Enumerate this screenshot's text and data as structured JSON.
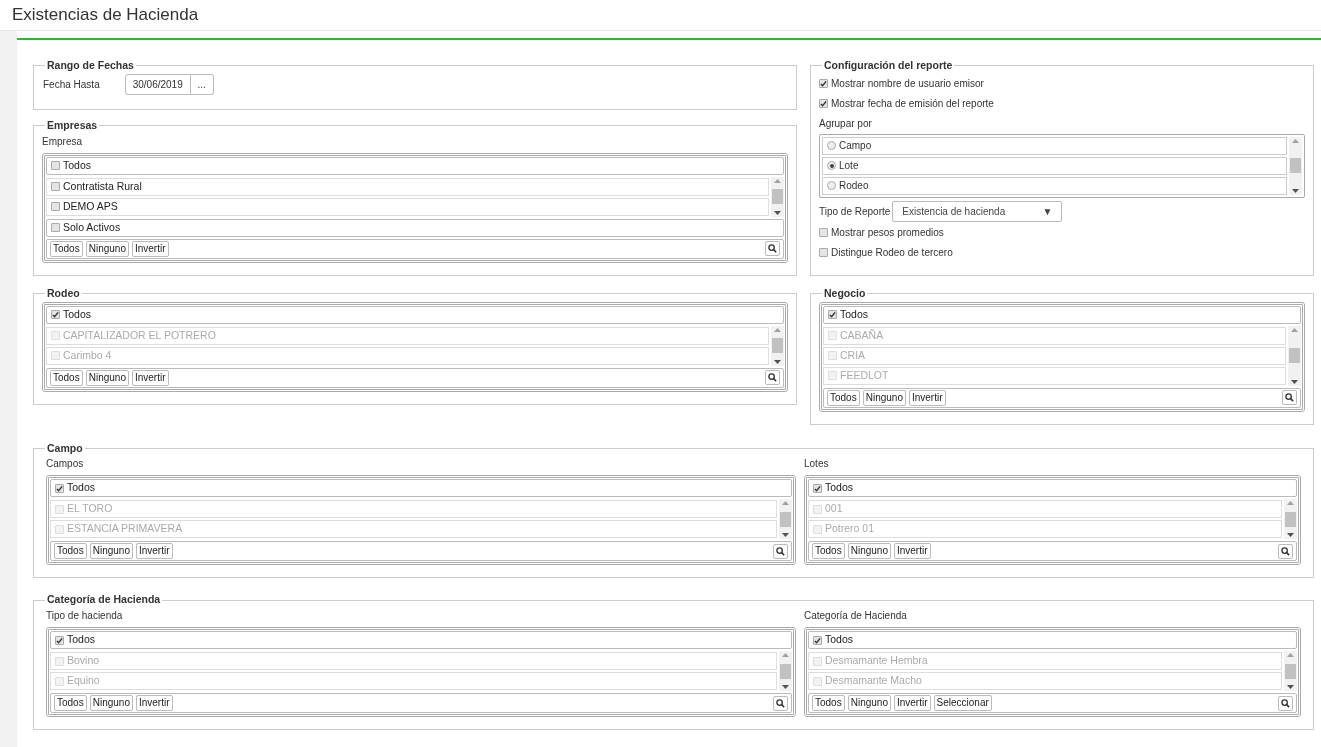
{
  "title": "Existencias de Hacienda",
  "date_range": {
    "legend": "Rango de Fechas",
    "label": "Fecha Hasta",
    "value": "30/06/2019",
    "button": "..."
  },
  "empresas": {
    "legend": "Empresas",
    "label": "Empresa",
    "list": {
      "all": {
        "label": "Todos",
        "checked": false
      },
      "items": [
        {
          "label": "Contratista Rural",
          "checked": false,
          "disabled": false
        },
        {
          "label": "DEMO APS",
          "checked": false,
          "disabled": false
        }
      ],
      "extra": {
        "label": "Solo Activos",
        "checked": false
      },
      "actions": [
        "Todos",
        "Ninguno",
        "Invertir"
      ]
    }
  },
  "config": {
    "legend": "Configuración del reporte",
    "options_top": [
      {
        "label": "Mostrar nombre de usuario emisor",
        "checked": true
      },
      {
        "label": "Mostrar fecha de emisión del reporte",
        "checked": true
      }
    ],
    "group_by": {
      "label": "Agrupar por",
      "options": [
        {
          "label": "Campo",
          "selected": false
        },
        {
          "label": "Lote",
          "selected": true
        },
        {
          "label": "Rodeo",
          "selected": false
        }
      ]
    },
    "report_type": {
      "label": "Tipo de Reporte",
      "value": "Existencia de hacienda",
      "caret": "▼"
    },
    "options_bottom": [
      {
        "label": "Mostrar pesos promedios",
        "checked": false
      },
      {
        "label": "Distingue Rodeo de tercero",
        "checked": false
      }
    ]
  },
  "rodeo": {
    "legend": "Rodeo",
    "list": {
      "all": {
        "label": "Todos",
        "checked": true
      },
      "items": [
        {
          "label": "CAPITALIZADOR EL POTRERO",
          "checked": false,
          "disabled": true
        },
        {
          "label": "Carimbo 4",
          "checked": false,
          "disabled": true
        }
      ],
      "actions": [
        "Todos",
        "Ninguno",
        "Invertir"
      ]
    }
  },
  "negocio": {
    "legend": "Negocio",
    "list": {
      "all": {
        "label": "Todos",
        "checked": true
      },
      "items": [
        {
          "label": "CABAÑA",
          "checked": false,
          "disabled": true
        },
        {
          "label": "CRIA",
          "checked": false,
          "disabled": true
        },
        {
          "label": "FEEDLOT",
          "checked": false,
          "disabled": true
        }
      ],
      "actions": [
        "Todos",
        "Ninguno",
        "Invertir"
      ]
    }
  },
  "campo": {
    "legend": "Campo",
    "columns": [
      {
        "label": "Campos",
        "list": {
          "all": {
            "label": "Todos",
            "checked": true
          },
          "items": [
            {
              "label": "EL TORO",
              "checked": false,
              "disabled": true
            },
            {
              "label": "ESTANCIA PRIMAVERA",
              "checked": false,
              "disabled": true
            }
          ],
          "actions": [
            "Todos",
            "Ninguno",
            "Invertir"
          ]
        }
      },
      {
        "label": "Lotes",
        "list": {
          "all": {
            "label": "Todos",
            "checked": true
          },
          "items": [
            {
              "label": "001",
              "checked": false,
              "disabled": true
            },
            {
              "label": "Potrero 01",
              "checked": false,
              "disabled": true
            }
          ],
          "actions": [
            "Todos",
            "Ninguno",
            "Invertir"
          ]
        }
      }
    ]
  },
  "categoria": {
    "legend": "Categoría de Hacienda",
    "columns": [
      {
        "label": "Tipo de hacienda",
        "list": {
          "all": {
            "label": "Todos",
            "checked": true
          },
          "items": [
            {
              "label": "Bovino",
              "checked": false,
              "disabled": true
            },
            {
              "label": "Equino",
              "checked": false,
              "disabled": true
            }
          ],
          "actions": [
            "Todos",
            "Ninguno",
            "Invertir"
          ]
        }
      },
      {
        "label": "Categoría de Hacienda",
        "list": {
          "all": {
            "label": "Todos",
            "checked": true
          },
          "items": [
            {
              "label": "Desmamante Hembra",
              "checked": false,
              "disabled": true
            },
            {
              "label": "Desmamante Macho",
              "checked": false,
              "disabled": true
            }
          ],
          "actions": [
            "Todos",
            "Ninguno",
            "Invertir",
            "Seleccionar"
          ]
        }
      }
    ]
  }
}
